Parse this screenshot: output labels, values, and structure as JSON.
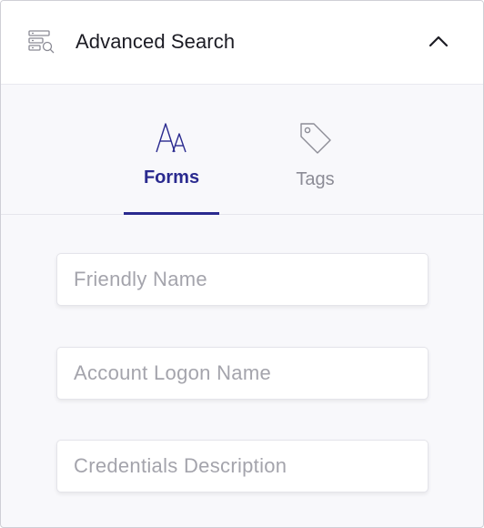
{
  "header": {
    "icon": "search-list-icon",
    "title": "Advanced Search",
    "collapse_icon": "chevron-up-icon"
  },
  "tabs": [
    {
      "label": "Forms",
      "icon": "font-size-icon",
      "active": true
    },
    {
      "label": "Tags",
      "icon": "tag-icon",
      "active": false
    }
  ],
  "fields": [
    {
      "placeholder": "Friendly Name",
      "value": ""
    },
    {
      "placeholder": "Account Logon Name",
      "value": ""
    },
    {
      "placeholder": "Credentials Description",
      "value": ""
    }
  ],
  "colors": {
    "accent": "#2a2a8f",
    "inactive_tab": "#8c8c96",
    "background": "#f8f8fb",
    "placeholder": "#a4a4ac"
  }
}
